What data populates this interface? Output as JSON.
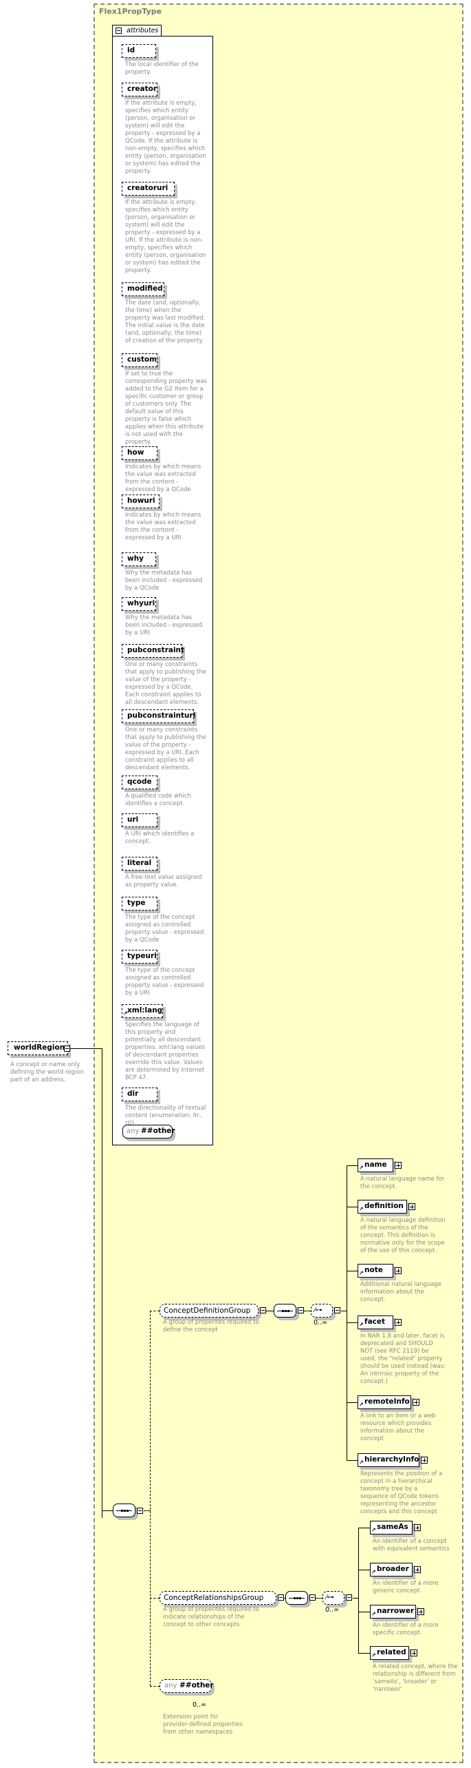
{
  "type_name": "Flex1PropType",
  "attributes_label": "attributes",
  "attributes": [
    {
      "name": "id",
      "desc": "The local identifier of the property."
    },
    {
      "name": "creator",
      "desc": "If the attribute is empty, specifies which entity (person, organisation or system) will edit the property - expressed by a QCode. If the attribute is non-empty, specifies which entity (person, organisation or system) has edited the property."
    },
    {
      "name": "creatoruri",
      "desc": "If the attribute is empty, specifies which entity (person, organisation or system) will edit the property - expressed by a URI. If the attribute is non-empty, specifies which entity (person, organisation or system) has edited the property."
    },
    {
      "name": "modified",
      "desc": "The date (and, optionally, the time) when the property was last modified. The initial value is the date (and, optionally, the time) of creation of the property."
    },
    {
      "name": "custom",
      "desc": "If set to true the corresponding property was added to the G2 Item for a specific customer or group of customers only. The default value of this property is false which applies when this attribute is not used with the property."
    },
    {
      "name": "how",
      "desc": "Indicates by which means the value was extracted from the content - expressed by a QCode"
    },
    {
      "name": "howuri",
      "desc": "Indicates by which means the value was extracted from the content - expressed by a URI"
    },
    {
      "name": "why",
      "desc": "Why the metadata has been included - expressed by a QCode"
    },
    {
      "name": "whyuri",
      "desc": "Why the metadata has been included - expressed by a URI"
    },
    {
      "name": "pubconstraint",
      "desc": "One or many constraints that apply to publishing the value of the property - expressed by a QCode. Each constraint applies to all descendant elements."
    },
    {
      "name": "pubconstrainturi",
      "desc": "One or many constraints that apply to publishing the value of the property - expressed by a URI. Each constraint applies to all descendant elements."
    },
    {
      "name": "qcode",
      "desc": "A qualified code which identifies a concept."
    },
    {
      "name": "uri",
      "desc": "A URI which identifies a concept."
    },
    {
      "name": "literal",
      "desc": "A free-text value assigned as property value."
    },
    {
      "name": "type",
      "desc": "The type of the concept assigned as controlled property value - expressed by a QCode"
    },
    {
      "name": "typeuri",
      "desc": "The type of the concept assigned as controlled property value - expressed by a URI"
    },
    {
      "name": "xml:lang",
      "desc": "Specifies the language of this property and potentially all descendant properties. xml:lang values of descendant properties override this value. Values are determined by Internet BCP 47."
    },
    {
      "name": "dir",
      "desc": "The directionality of textual content (enumeration: ltr, rtl)"
    }
  ],
  "attr_any": {
    "prefix": "any",
    "ns": "##other"
  },
  "root": {
    "name": "worldRegion",
    "desc": "A concept or name only defining the world region part of an address."
  },
  "groups": [
    {
      "name": "ConceptDefinitionGroup",
      "desc": "A group of properites required to define the concept",
      "multiplicity": "0..∞",
      "elements": [
        {
          "name": "name",
          "desc": "A natural language name for the concept."
        },
        {
          "name": "definition",
          "desc": "A natural language definition of the semantics of the concept. This definition is normative only for the scope of the use of this concept."
        },
        {
          "name": "note",
          "desc": "Additional natural language information about the concept."
        },
        {
          "name": "facet",
          "desc": "In NAR 1.8 and later, facet is deprecated and SHOULD NOT (see RFC 2119) be used, the \"related\" property should be used instead (was: An intrinsic property of the concept.)"
        },
        {
          "name": "remoteInfo",
          "desc": "A link to an item or a web resource which provides information about the concept"
        },
        {
          "name": "hierarchyInfo",
          "desc": "Represents the position of a concept in a hierarchical taxonomy tree by a sequence of QCode tokens representing the ancestor concepts and this concept"
        }
      ]
    },
    {
      "name": "ConceptRelationshipsGroup",
      "desc": "A group of properites required to indicate relationships of the concept to other concepts",
      "multiplicity": "0..∞",
      "elements": [
        {
          "name": "sameAs",
          "desc": "An identifier of a concept with equivalent semantics"
        },
        {
          "name": "broader",
          "desc": "An identifier of a more generic concept."
        },
        {
          "name": "narrower",
          "desc": "An identifier of a more specific concept."
        },
        {
          "name": "related",
          "desc": "A related concept, where the relationship is different from 'sameAs', 'broader' or 'narrower'."
        }
      ]
    }
  ],
  "any_other": {
    "prefix": "any",
    "ns": "##other",
    "multiplicity": "0..∞",
    "desc": "Extension point for provider-defined properties from other namespaces"
  }
}
